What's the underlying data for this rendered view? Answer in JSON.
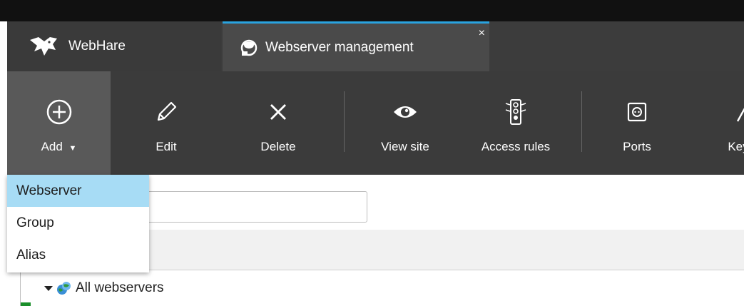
{
  "tabs": {
    "home_label": "WebHare",
    "active_label": "Webserver management",
    "close_glyph": "×"
  },
  "toolbar": {
    "buttons": [
      {
        "label": "Add",
        "icon": "plus-circle-icon",
        "dropdown_glyph": "▼"
      },
      {
        "label": "Edit",
        "icon": "pencil-icon"
      },
      {
        "label": "Delete",
        "icon": "x-icon"
      },
      {
        "label": "View site",
        "icon": "eye-icon"
      },
      {
        "label": "Access rules",
        "icon": "traffic-light-icon"
      },
      {
        "label": "Ports",
        "icon": "socket-icon"
      },
      {
        "label": "Key",
        "icon": "key-icon"
      }
    ]
  },
  "add_menu": {
    "items": [
      "Webserver",
      "Group",
      "Alias"
    ],
    "highlighted": "Webserver"
  },
  "search": {
    "value": "",
    "placeholder": ""
  },
  "tree": {
    "rows": [
      {
        "label": "All webservers",
        "icon": "globe-network-icon",
        "expanded": true
      }
    ]
  },
  "colors": {
    "active_tab_accent": "#2aa3df",
    "menu_highlight": "#a7dcf5",
    "toolbar_bg": "#3b3b3b"
  }
}
